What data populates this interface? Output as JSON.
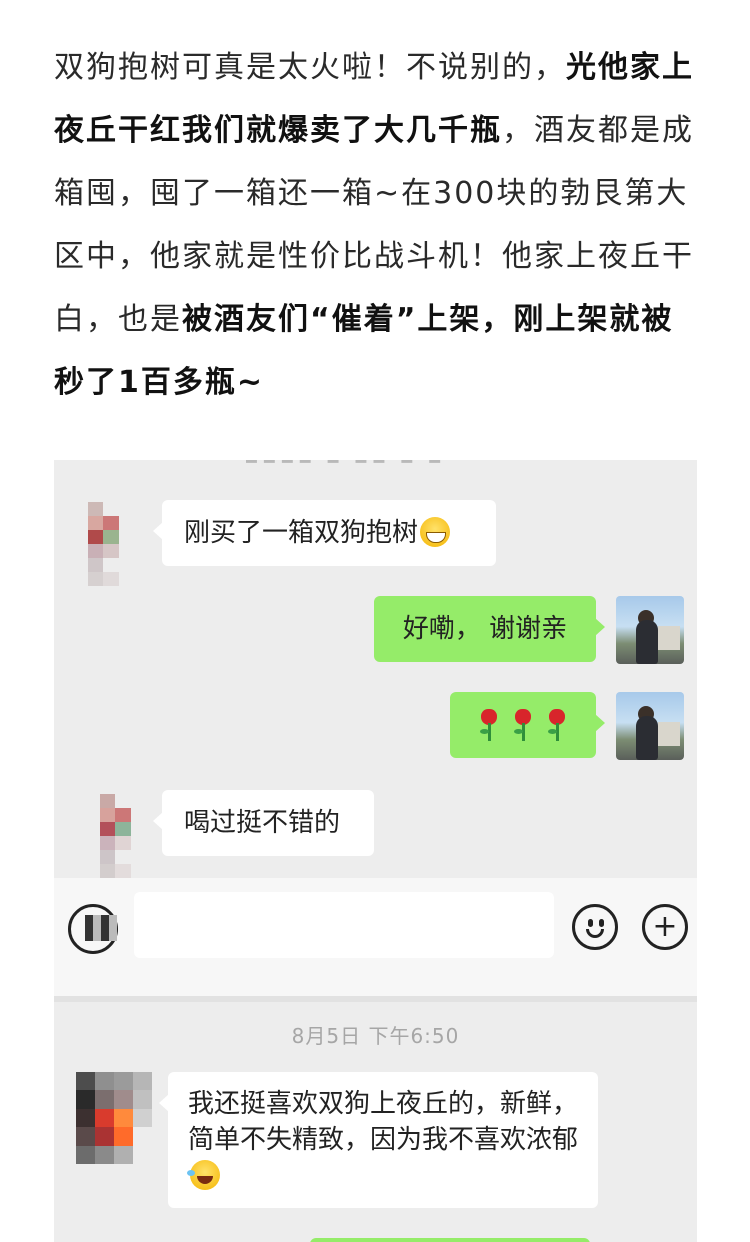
{
  "article": {
    "s1": "双狗抱树可真是太火啦！不说别的，",
    "s1_bold": "光他家上夜丘干红我们就爆卖了大几千瓶",
    "s2": "，酒友都是成箱囤，囤了一箱还一箱~在300块的勃艮第大区中，他家就是性价比战斗机！他家上夜丘干白，也是",
    "s2_bold": "被酒友们“催着”上架，刚上架就被秒了1百多瓶~"
  },
  "chat1": {
    "msg1": "刚买了一箱双狗抱树",
    "msg2": "好嘞， 谢谢亲",
    "msg3_emojis": [
      "rose",
      "rose",
      "rose"
    ],
    "msg4": "喝过挺不错的"
  },
  "input_bar": {
    "voice_icon": "voice-icon",
    "emoji_icon": "emoji-icon",
    "plus_icon": "plus-icon",
    "plus_glyph": "+"
  },
  "chat2": {
    "timestamp": "8月5日 下午6:50",
    "msg1": "我还挺喜欢双狗上夜丘的，新鲜，简单不失精致，因为我不喜欢浓郁"
  },
  "colors": {
    "chat_bg": "#ededed",
    "bubble_self": "#95ec69",
    "bubble_other": "#ffffff"
  }
}
